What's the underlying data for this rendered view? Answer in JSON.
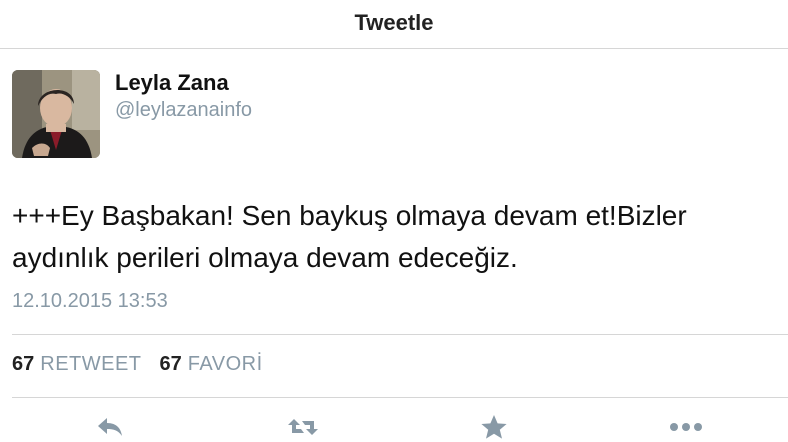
{
  "nav": {
    "title": "Tweetle"
  },
  "tweet": {
    "display_name": "Leyla Zana",
    "handle": "@leylazanainfo",
    "text": "+++Ey Başbakan! Sen baykuş olmaya devam et!Bizler aydınlık perileri olmaya devam edeceğiz.",
    "timestamp": "12.10.2015 13:53"
  },
  "stats": {
    "retweet_count": "67",
    "retweet_label": "RETWEET",
    "favorite_count": "67",
    "favorite_label": "FAVORİ"
  },
  "actions": [
    "reply-icon",
    "retweet-icon",
    "favorite-star-icon",
    "more-dots-icon"
  ],
  "colors": {
    "muted": "#8899a6",
    "text": "#111111",
    "divider": "#d6d6d6"
  }
}
